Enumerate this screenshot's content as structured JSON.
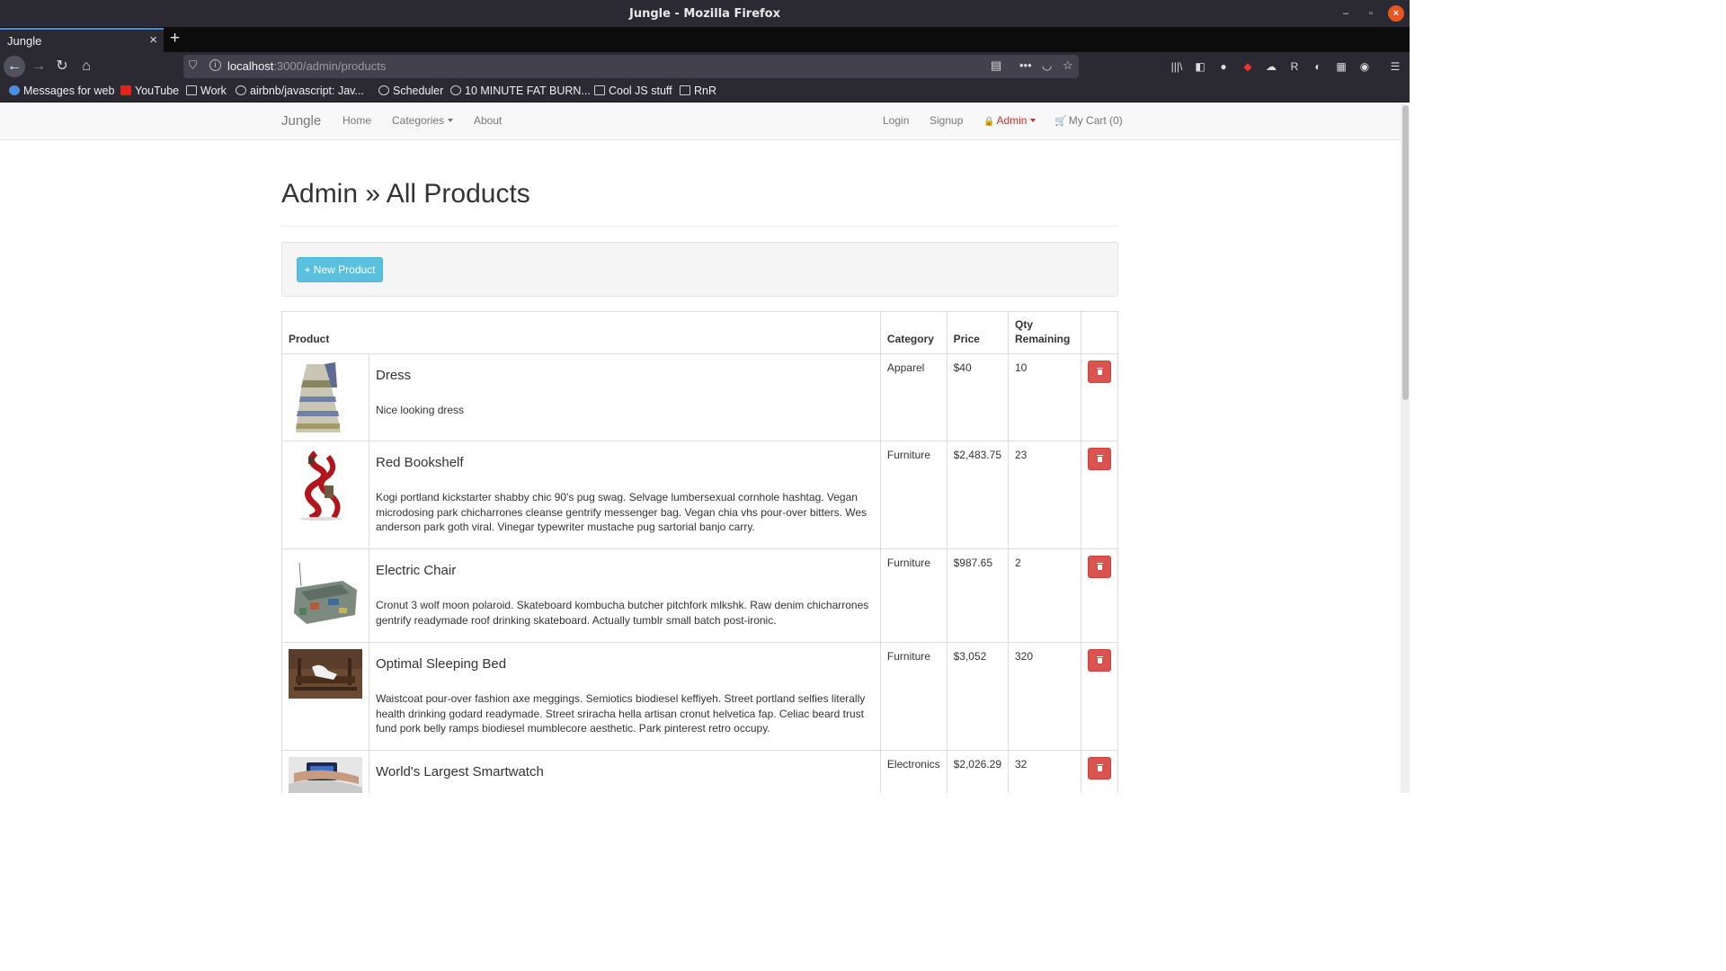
{
  "window": {
    "title": "Jungle - Mozilla Firefox"
  },
  "tabs": [
    {
      "label": "Jungle"
    }
  ],
  "urlbar": {
    "host": "localhost",
    "path": ":3000/admin/products"
  },
  "bookmarks": [
    {
      "label": "Messages for web",
      "icon": "messages-icon"
    },
    {
      "label": "YouTube",
      "icon": "youtube-icon"
    },
    {
      "label": "Work",
      "icon": "folder-icon"
    },
    {
      "label": "airbnb/javascript: Jav...",
      "icon": "github-icon"
    },
    {
      "label": "Scheduler",
      "icon": "globe-icon"
    },
    {
      "label": "10 MINUTE FAT BURN...",
      "icon": "globe-icon"
    },
    {
      "label": "Cool JS stuff",
      "icon": "folder-icon"
    },
    {
      "label": "RnR",
      "icon": "folder-icon"
    }
  ],
  "site_nav": {
    "brand": "Jungle",
    "home": "Home",
    "categories": "Categories",
    "about": "About",
    "login": "Login",
    "signup": "Signup",
    "admin": "Admin",
    "cart": "My Cart (0)"
  },
  "page": {
    "title": "Admin » All Products",
    "new_product": "+ New Product"
  },
  "table": {
    "headers": {
      "product": "Product",
      "category": "Category",
      "price": "Price",
      "qty": "Qty Remaining"
    },
    "rows": [
      {
        "name": "Dress",
        "description": "Nice looking dress",
        "category": "Apparel",
        "price": "$40",
        "qty": "10",
        "image": "dress"
      },
      {
        "name": "Red Bookshelf",
        "description": "Kogi portland kickstarter shabby chic 90's pug swag. Selvage lumbersexual cornhole hashtag. Vegan microdosing park chicharrones cleanse gentrify messenger bag. Vegan chia vhs pour-over bitters. Wes anderson park goth viral. Vinegar typewriter mustache pug sartorial banjo carry.",
        "category": "Furniture",
        "price": "$2,483.75",
        "qty": "23",
        "image": "bookshelf"
      },
      {
        "name": "Electric Chair",
        "description": "Cronut 3 wolf moon polaroid. Skateboard kombucha butcher pitchfork mlkshk. Raw denim chicharrones gentrify readymade roof drinking skateboard. Actually tumblr small batch post-ironic.",
        "category": "Furniture",
        "price": "$987.65",
        "qty": "2",
        "image": "chair"
      },
      {
        "name": "Optimal Sleeping Bed",
        "description": "Waistcoat pour-over fashion axe meggings. Semiotics biodiesel keffiyeh. Street portland selfies literally health drinking godard readymade. Street sriracha hella artisan cronut helvetica fap. Celiac beard trust fund pork belly ramps biodiesel mumblecore aesthetic. Park pinterest retro occupy.",
        "category": "Furniture",
        "price": "$3,052",
        "qty": "320",
        "image": "bed"
      },
      {
        "name": "World's Largest Smartwatch",
        "description": "",
        "category": "Electronics",
        "price": "$2,026.29",
        "qty": "32",
        "image": "smartwatch"
      }
    ]
  },
  "colors": {
    "admin": "#c9302c",
    "info_button": "#5bc0de",
    "danger_button": "#d9534f",
    "firefox_chrome": "#2b2a33"
  }
}
